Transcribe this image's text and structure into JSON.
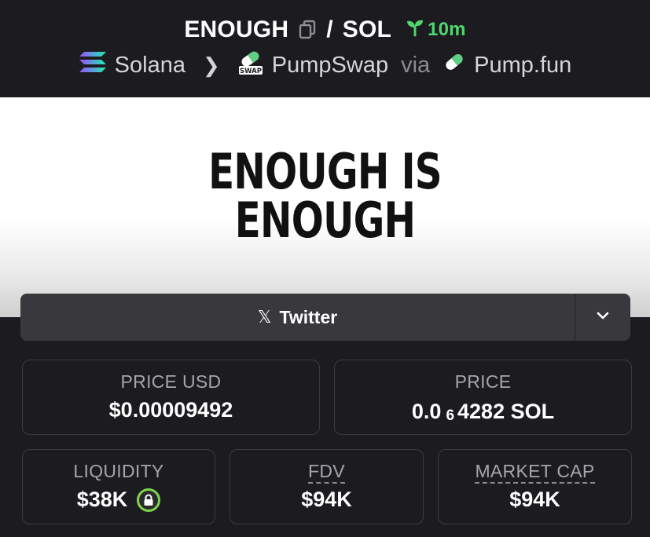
{
  "header": {
    "token_symbol": "ENOUGH",
    "separator": "/",
    "quote_symbol": "SOL",
    "age": "10m"
  },
  "breadcrumb": {
    "chain": "Solana",
    "dex": "PumpSwap",
    "via_label": "via",
    "launchpad": "Pump.fun",
    "dex_icon_text": "SWAP"
  },
  "banner": {
    "line1": "ENOUGH IS",
    "line2": "ENOUGH"
  },
  "social": {
    "twitter_label": "Twitter"
  },
  "stats": {
    "price_usd_label": "PRICE USD",
    "price_usd_value": "$0.00009492",
    "price_label": "PRICE",
    "price_prefix": "0.0",
    "price_zero_count": "6",
    "price_digits": "4282 SOL",
    "liquidity_label": "LIQUIDITY",
    "liquidity_value": "$38K",
    "fdv_label": "FDV",
    "fdv_value": "$94K",
    "market_cap_label": "MARKET CAP",
    "market_cap_value": "$94K"
  },
  "colors": {
    "background": "#1c1c20",
    "accent_green": "#4fd66e",
    "lock_green": "#7fd44a"
  }
}
